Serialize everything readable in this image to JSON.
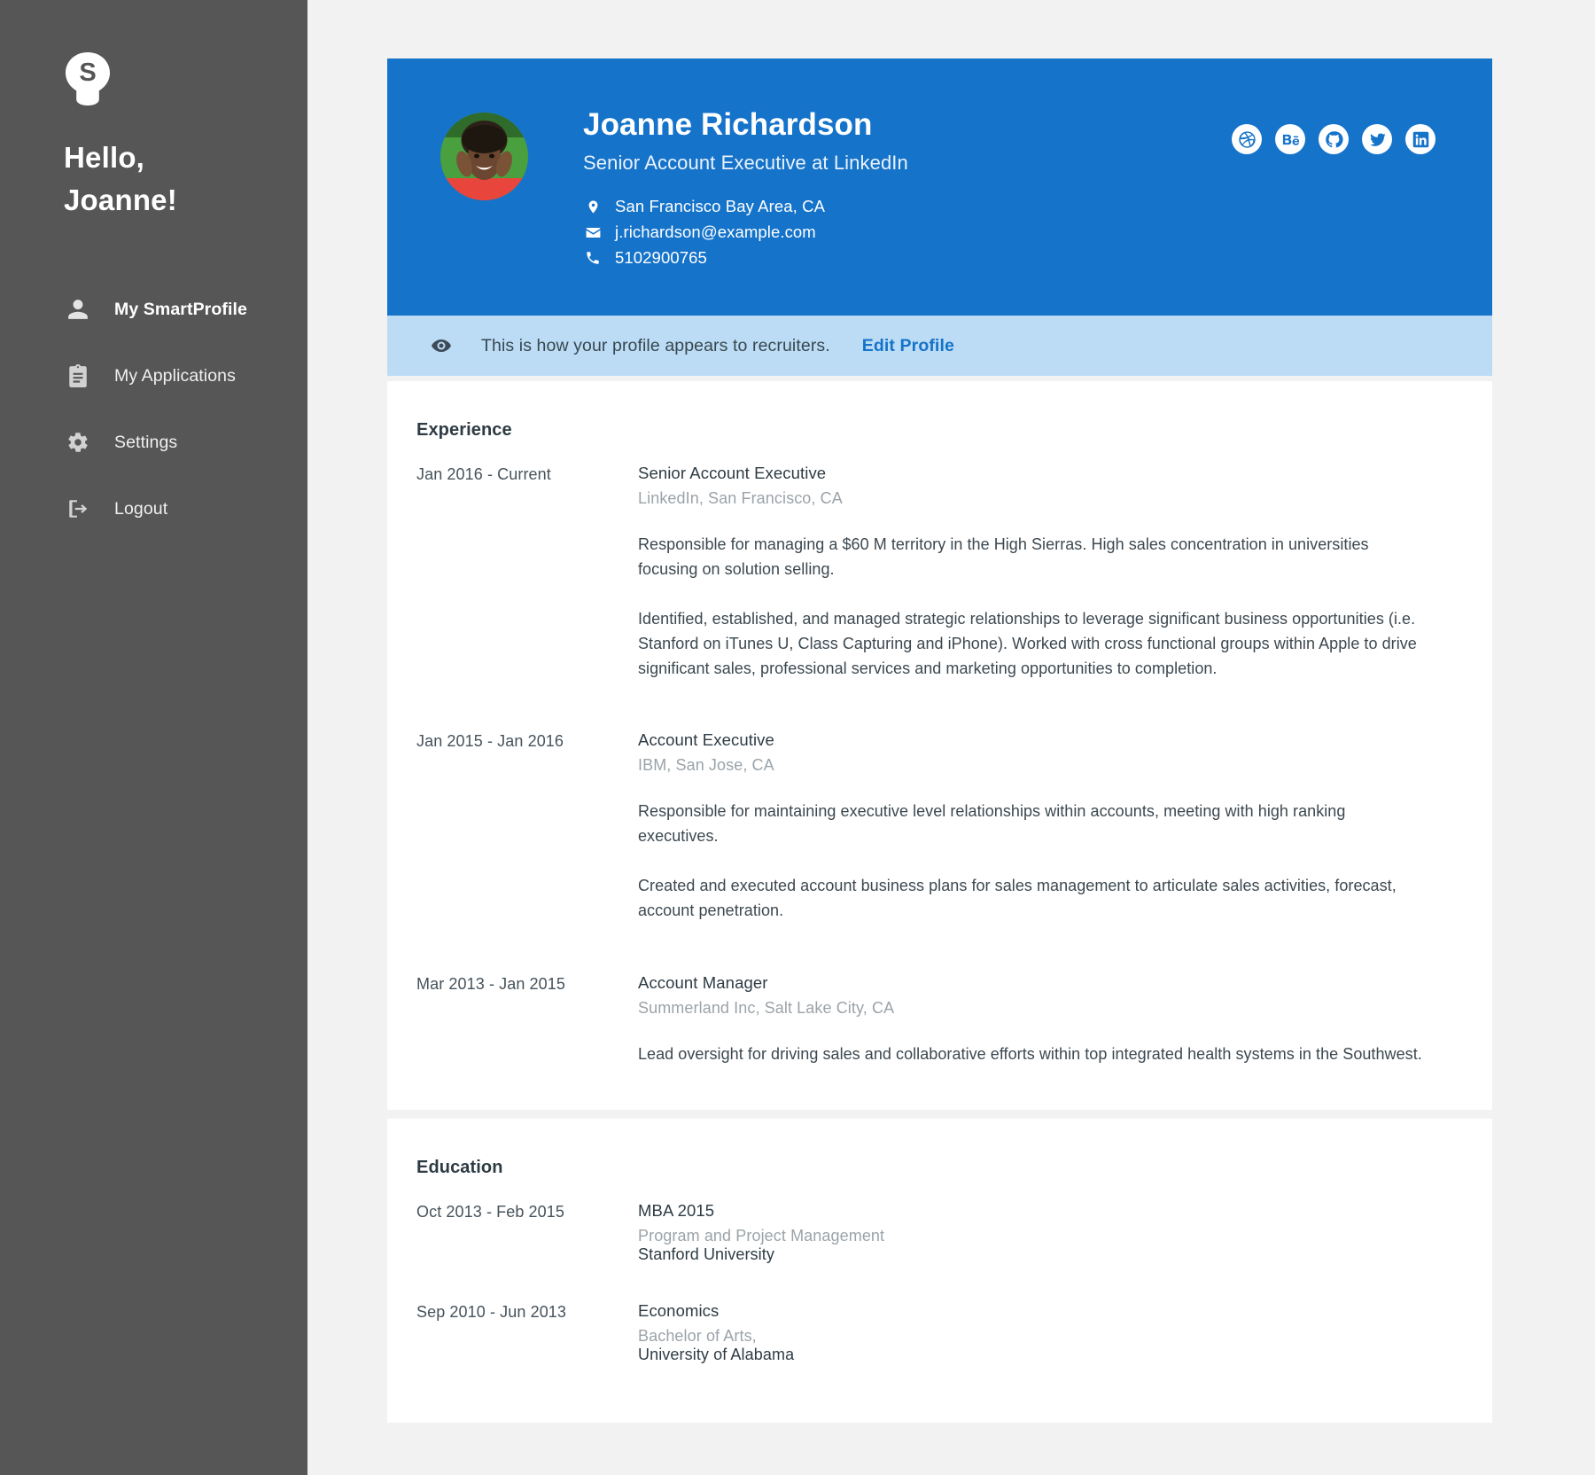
{
  "sidebar": {
    "logo_letter": "S",
    "logo_icon": "lightbulb-icon",
    "greeting_line1": "Hello,",
    "greeting_line2": "Joanne!",
    "items": [
      {
        "label": "My SmartProfile",
        "icon": "person-icon",
        "active": true
      },
      {
        "label": "My Applications",
        "icon": "clipboard-icon",
        "active": false
      },
      {
        "label": "Settings",
        "icon": "gear-icon",
        "active": false
      },
      {
        "label": "Logout",
        "icon": "logout-icon",
        "active": false
      }
    ]
  },
  "profile": {
    "name": "Joanne Richardson",
    "title": "Senior Account Executive at LinkedIn",
    "avatar_alt": "Smiling woman with hands on cheeks",
    "accent_color": "#1573ca",
    "contacts": [
      {
        "icon": "location-pin-icon",
        "value": "San Francisco Bay Area, CA"
      },
      {
        "icon": "envelope-icon",
        "value": "j.richardson@example.com"
      },
      {
        "icon": "phone-icon",
        "value": "5102900765"
      }
    ],
    "socials": [
      {
        "name": "dribbble-icon",
        "label": "Dribbble"
      },
      {
        "name": "behance-icon",
        "label": "Behance"
      },
      {
        "name": "github-icon",
        "label": "GitHub"
      },
      {
        "name": "twitter-icon",
        "label": "Twitter"
      },
      {
        "name": "linkedin-icon",
        "label": "LinkedIn"
      }
    ]
  },
  "notice": {
    "icon": "eye-icon",
    "text": "This is how your profile appears to recruiters.",
    "link_label": "Edit Profile",
    "bg_color": "#bcdcf5",
    "link_color": "#1573ca"
  },
  "experience": {
    "section_title": "Experience",
    "entries": [
      {
        "date": "Jan 2016 - Current",
        "role": "Senior Account Executive",
        "org": "LinkedIn, San Francisco, CA",
        "p1": "Responsible for managing a $60 M territory in the High Sierras. High sales concentration in universities focusing on solution selling.",
        "p2": "Identified, established, and managed strategic relationships to leverage significant business opportunities (i.e. Stanford on iTunes U, Class Capturing and iPhone). Worked with cross functional groups within Apple to drive significant sales, professional services and marketing opportunities to completion."
      },
      {
        "date": "Jan 2015 - Jan 2016",
        "role": "Account Executive",
        "org": "IBM, San Jose, CA",
        "p1": "Responsible for maintaining executive level relationships within accounts, meeting with high ranking executives.",
        "p2": "Created and executed account business plans for sales management to articulate sales activities, forecast, account penetration."
      },
      {
        "date": "Mar 2013 - Jan 2015",
        "role": "Account Manager",
        "org": "Summerland Inc, Salt Lake City, CA",
        "p1": "Lead oversight for driving sales and collaborative efforts within top integrated health systems in the Southwest.",
        "p2": ""
      }
    ]
  },
  "education": {
    "section_title": "Education",
    "entries": [
      {
        "date": "Oct 2013 - Feb 2015",
        "degree": "MBA 2015",
        "field": "Program and Project Management",
        "school": "Stanford University"
      },
      {
        "date": "Sep 2010 - Jun 2013",
        "degree": "Economics",
        "field": "Bachelor of Arts,",
        "school": "University of Alabama"
      }
    ]
  }
}
